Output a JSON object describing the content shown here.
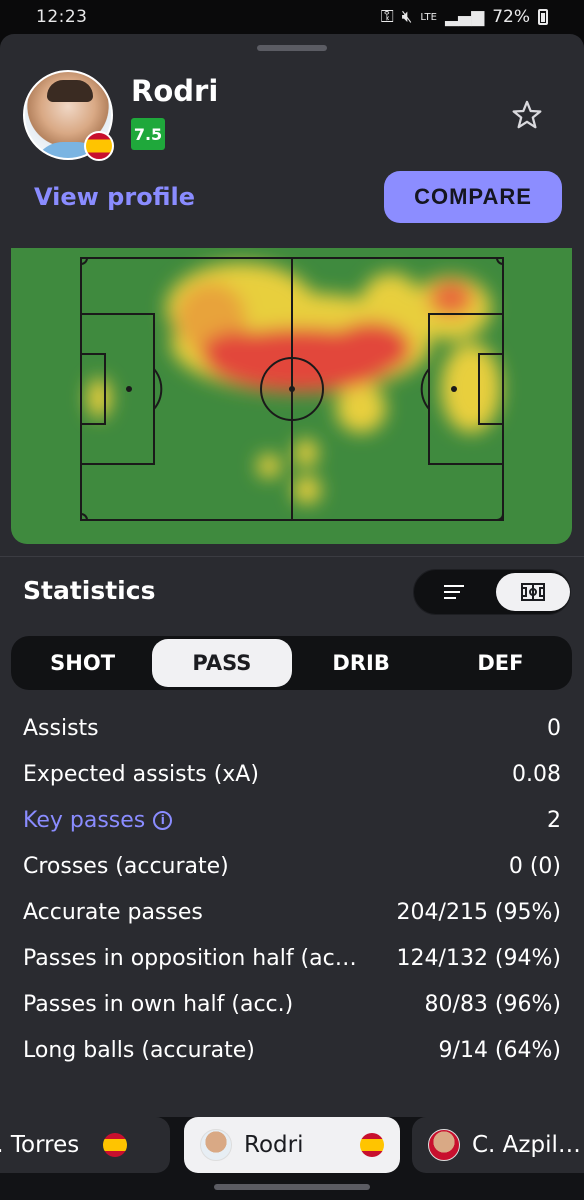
{
  "status_bar": {
    "time": "12:23",
    "network": "LTE",
    "battery": "72%"
  },
  "player": {
    "name": "Rodri",
    "rating": "7.5",
    "rating_color": "#1fa83b",
    "nationality_flag": "spain-flag"
  },
  "actions": {
    "view_profile": "View profile",
    "compare": "COMPARE"
  },
  "heatmap": {
    "pitch_color": "#3f8a3e",
    "hot_color": "#e2463a",
    "warm_color": "#f0d63a"
  },
  "statistics": {
    "title": "Statistics",
    "view_options": [
      "list-icon",
      "pitch-icon"
    ],
    "selected_view": "pitch-icon",
    "tabs": [
      {
        "label": "SHOT"
      },
      {
        "label": "PASS"
      },
      {
        "label": "DRIB"
      },
      {
        "label": "DEF"
      }
    ],
    "selected_tab": "PASS",
    "rows": [
      {
        "label": "Assists",
        "value": "0"
      },
      {
        "label": "Expected assists (xA)",
        "value": "0.08"
      },
      {
        "label": "Key passes",
        "value": "2"
      },
      {
        "label": "Crosses (accurate)",
        "value": "0 (0)"
      },
      {
        "label": "Accurate passes",
        "value": "204/215 (95%)"
      },
      {
        "label": "Passes in opposition half (accurate)",
        "value": "124/132 (94%)"
      },
      {
        "label": "Passes in own half (acc.)",
        "value": "80/83 (96%)"
      },
      {
        "label": "Long balls (accurate)",
        "value": "9/14 (64%)"
      }
    ]
  },
  "player_switcher": [
    {
      "name": "P. Torres"
    },
    {
      "name": "Rodri"
    },
    {
      "name": "C. Azpilicueta"
    }
  ],
  "accent_color": "#8c8dff"
}
